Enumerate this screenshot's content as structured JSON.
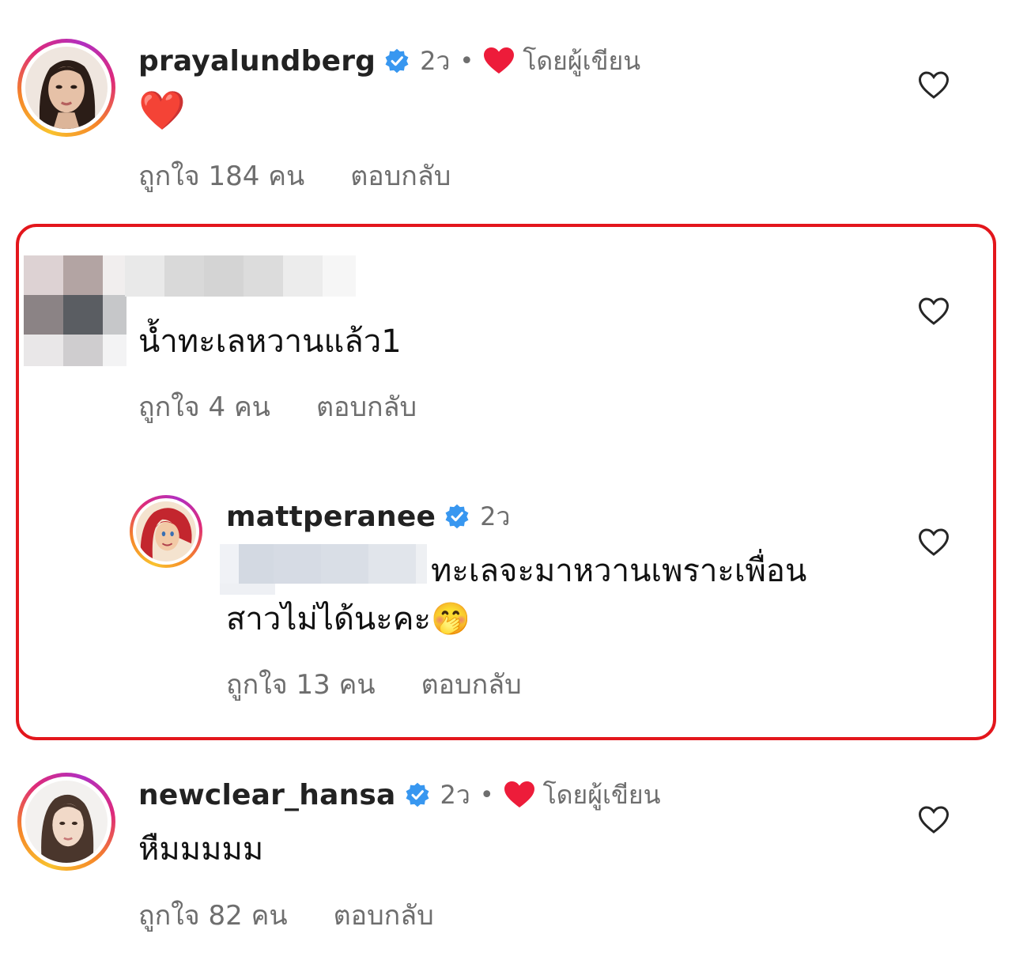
{
  "colors": {
    "verified": "#3897f0",
    "heart": "#ed1c3a",
    "highlight_border": "#e3161c",
    "muted_text": "#6e6e6e"
  },
  "comments": [
    {
      "username": "prayalundberg",
      "verified": true,
      "time": "2ว",
      "dot": "•",
      "liked_by_author_label": "โดยผู้เขียน",
      "text": "❤️",
      "likes_label": "ถูกใจ 184 คน",
      "reply_label": "ตอบกลับ"
    },
    {
      "username": "",
      "text": "น้ำทะเลหวานแล้ว1",
      "likes_label": "ถูกใจ 4 คน",
      "reply_label": "ตอบกลับ",
      "reply": {
        "username": "mattperanee",
        "verified": true,
        "time": "2ว",
        "text_line1": "ทะเลจะมาหวานเพราะเพื่อน",
        "text_line2": "สาวไม่ได้นะคะ🤭",
        "likes_label": "ถูกใจ 13 คน",
        "reply_label": "ตอบกลับ"
      }
    },
    {
      "username": "newclear_hansa",
      "verified": true,
      "time": "2ว",
      "dot": "•",
      "liked_by_author_label": "โดยผู้เขียน",
      "text": "หืมมมมม",
      "likes_label": "ถูกใจ 82 คน",
      "reply_label": "ตอบกลับ"
    }
  ]
}
